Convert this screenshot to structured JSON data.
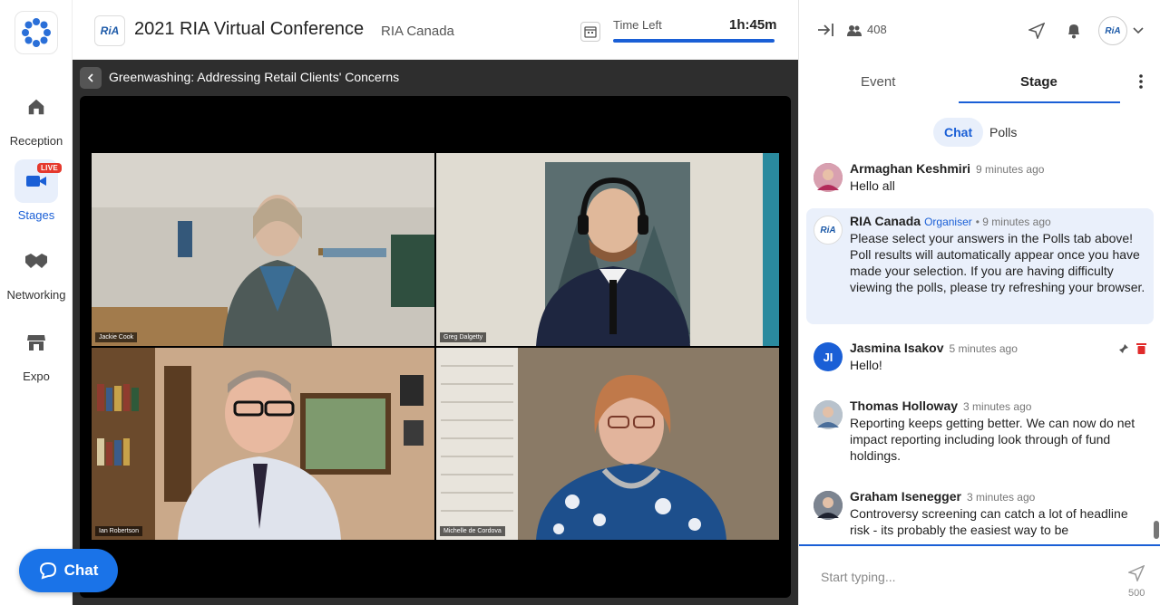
{
  "nav": {
    "items": [
      {
        "label": "Reception",
        "icon": "home-icon"
      },
      {
        "label": "Stages",
        "icon": "video-camera-icon",
        "badge": "LIVE"
      },
      {
        "label": "Networking",
        "icon": "handshake-icon"
      },
      {
        "label": "Expo",
        "icon": "store-icon"
      }
    ]
  },
  "header": {
    "logo_text": "RiA",
    "title": "2021 RIA Virtual Conference",
    "organizer": "RIA Canada",
    "time_left_label": "Time Left",
    "time_left_value": "1h:45m"
  },
  "stage": {
    "session_title": "Greenwashing: Addressing Retail Clients' Concerns",
    "participants": [
      {
        "name": "Jackie Cook"
      },
      {
        "name": "Greg Dalgetty"
      },
      {
        "name": "Ian Robertson"
      },
      {
        "name": "Michelle de Cordova"
      }
    ]
  },
  "right_panel": {
    "attendee_count": "408",
    "tabs": [
      "Event",
      "Stage"
    ],
    "active_tab": "Stage",
    "subtabs": [
      "Chat",
      "Polls"
    ],
    "active_subtab": "Chat",
    "messages": [
      {
        "name": "Armaghan Keshmiri",
        "role": "",
        "time": "9 minutes ago",
        "text": "Hello all",
        "avatar": "photo"
      },
      {
        "name": "RIA Canada",
        "role": "Organiser",
        "time": "• 9 minutes ago",
        "text": "Please select your answers in the Polls tab above! Poll results will automatically appear once you have made your selection. If you are having difficulty viewing the polls, please try refreshing your browser.",
        "avatar": "RiA"
      },
      {
        "name": "Jasmina Isakov",
        "role": "",
        "time": "5 minutes ago",
        "text": "Hello!",
        "avatar": "JI"
      },
      {
        "name": "Thomas Holloway",
        "role": "",
        "time": "3 minutes ago",
        "text": "Reporting keeps getting better. We can now do net impact reporting including look through of fund holdings.",
        "avatar": "photo"
      },
      {
        "name": "Graham Isenegger",
        "role": "",
        "time": "3 minutes ago",
        "text": "Controversy screening can catch a lot of headline risk - its probably the easiest way to be",
        "avatar": "photo"
      }
    ],
    "input_placeholder": "Start typing...",
    "char_limit": "500"
  },
  "chat_button": {
    "label": "Chat"
  },
  "colors": {
    "accent": "#1a5fd6",
    "live": "#e5392d",
    "fab": "#1a73e8"
  }
}
